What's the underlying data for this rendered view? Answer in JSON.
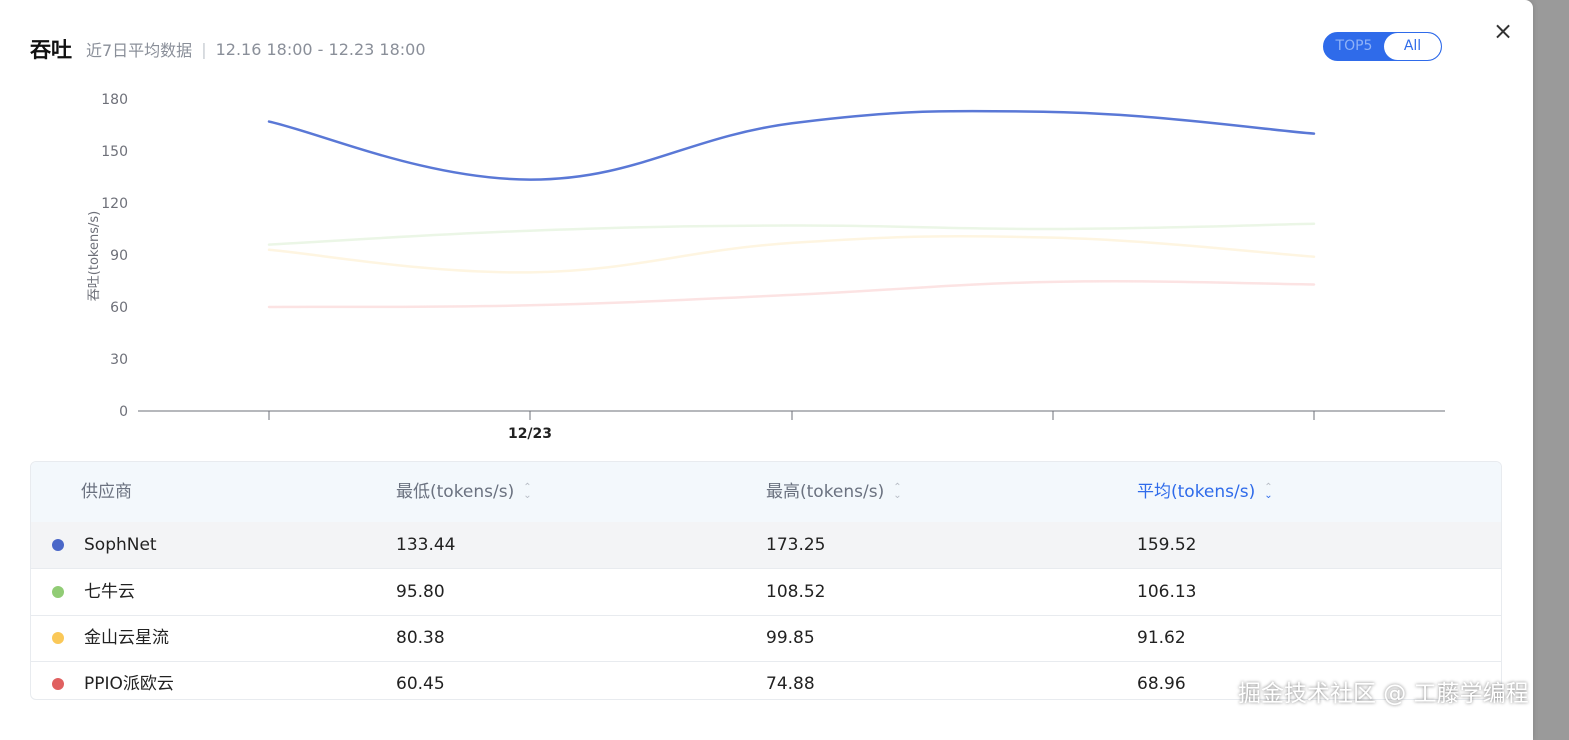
{
  "modal": {
    "title": "吞吐",
    "subtitle": "近7日平均数据",
    "separator": "|",
    "date_range": "12.16 18:00 - 12.23 18:00",
    "toggle": {
      "top5_label": "TOP5",
      "all_label": "All",
      "selected": "All"
    },
    "close_symbol": "×"
  },
  "chart_data": {
    "type": "line",
    "ylabel": "吞吐(tokens/s)",
    "xlabel": "",
    "ylim": [
      0,
      180
    ],
    "y_ticks": [
      "0",
      "30",
      "60",
      "90",
      "120",
      "150",
      "180"
    ],
    "x_tick_labels": [
      "",
      "12/23",
      "",
      "",
      ""
    ],
    "grid": false,
    "series": [
      {
        "name": "SophNet",
        "color": "#5a78d6",
        "opacity": 1.0,
        "values": [
          167,
          133.5,
          166,
          172.5,
          160
        ]
      },
      {
        "name": "七牛云",
        "color": "#91cc75",
        "opacity": 0.18,
        "values": [
          96,
          104,
          107,
          105,
          108
        ]
      },
      {
        "name": "金山云星流",
        "color": "#fac858",
        "opacity": 0.18,
        "values": [
          93,
          80,
          97,
          100,
          89
        ]
      },
      {
        "name": "PPIO派欧云",
        "color": "#ee6666",
        "opacity": 0.18,
        "values": [
          60,
          61,
          67,
          74.5,
          73
        ]
      }
    ]
  },
  "table": {
    "columns": [
      "供应商",
      "最低(tokens/s)",
      "最高(tokens/s)",
      "平均(tokens/s)"
    ],
    "sort_up": "⌃",
    "sort_down": "⌄",
    "rows": [
      {
        "provider": "SophNet",
        "color": "#4a67c8",
        "min": "133.44",
        "max": "173.25",
        "avg": "159.52"
      },
      {
        "provider": "七牛云",
        "color": "#91cc75",
        "min": "95.80",
        "max": "108.52",
        "avg": "106.13"
      },
      {
        "provider": "金山云星流",
        "color": "#fac858",
        "min": "80.38",
        "max": "99.85",
        "avg": "91.62"
      },
      {
        "provider": "PPIO派欧云",
        "color": "#e06060",
        "min": "60.45",
        "max": "74.88",
        "avg": "68.96"
      }
    ]
  },
  "watermark": "掘金技术社区 @ 工藤学编程"
}
